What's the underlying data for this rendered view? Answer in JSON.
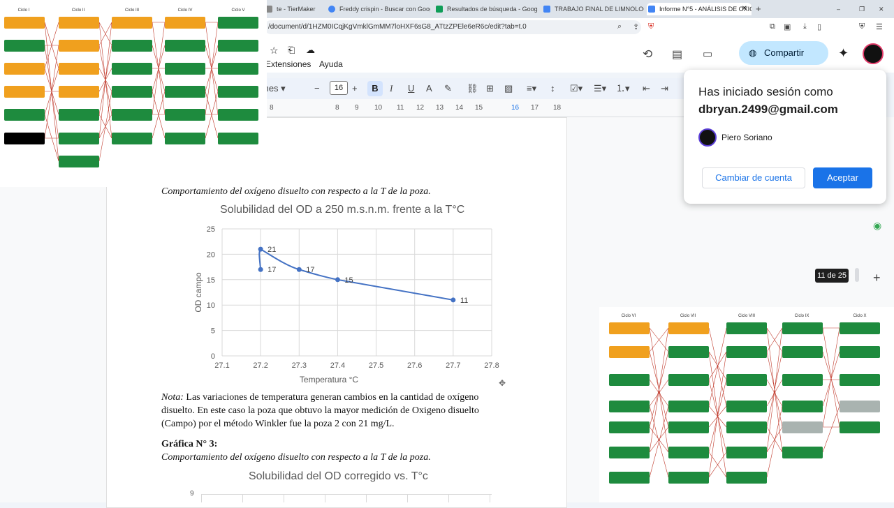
{
  "browser": {
    "tabs": [
      {
        "label": "te - TierMaker",
        "icon_color": "#888888"
      },
      {
        "label": "Freddy crispin - Buscar con Google",
        "icon_color": "#4285f4"
      },
      {
        "label": "Resultados de búsqueda - Google D",
        "icon_color": "#0f9d58"
      },
      {
        "label": "TRABAJO FINAL DE LIMNOLOGÍA M",
        "icon_color": "#4285f4"
      },
      {
        "label": "Informe N°5 - ANÁLISIS DE OXIG",
        "icon_color": "#4285f4"
      }
    ],
    "new_tab": "+",
    "window_controls": [
      "–",
      "❐",
      "✕"
    ],
    "url": "/document/d/1HZM0ICqjKgVmklGmMM7loHXF6sG8_ATtzZPEle6eR6c/edit?tab=t.0"
  },
  "docs": {
    "menu": [
      "Extensiones",
      "Ayuda"
    ],
    "share_label": "Compartir",
    "font_name": "mes",
    "font_size": "16",
    "ruler_numbers": [
      "8",
      "9",
      "10",
      "11",
      "12",
      "13",
      "14",
      "15",
      "16",
      "17",
      "18"
    ]
  },
  "document": {
    "caption1": "Comportamiento del oxígeno disuelto con respecto a la T de la poza.",
    "nota_label": "Nota:",
    "nota_text": " Las variaciones de temperatura generan cambios en la cantidad de oxígeno disuelto. En este caso la poza que obtuvo la mayor medición de Oxigeno disuelto (Campo) por el método Winkler fue la poza 2 con 21 mg/L.",
    "heading3": "Gráfica N° 3:",
    "caption2": "Comportamiento del oxígeno disuelto con respecto a la T de la poza.",
    "chart2_title": "Solubilidad del OD corregido vs. T°c",
    "chart2_ytick": "9"
  },
  "chart_data": {
    "type": "line",
    "title": "Solubilidad del OD a 250 m.s.n.m. frente a la T°C",
    "xlabel": "Temperatura °C",
    "ylabel": "OD campo",
    "xlim": [
      27.1,
      27.8
    ],
    "ylim": [
      0,
      25
    ],
    "xticks": [
      "27.1",
      "27.2",
      "27.3",
      "27.4",
      "27.5",
      "27.6",
      "27.7",
      "27.8"
    ],
    "yticks": [
      "0",
      "5",
      "10",
      "15",
      "20",
      "25"
    ],
    "grid": true,
    "series": [
      {
        "x": [
          27.2,
          27.2,
          27.3,
          27.4,
          27.7
        ],
        "y": [
          17,
          21,
          17,
          15,
          11
        ],
        "labels": [
          "17",
          "21",
          "17",
          "15",
          "11"
        ],
        "color": "#4472c4"
      }
    ]
  },
  "account_popup": {
    "line1": "Has iniciado sesión como",
    "email": "dbryan.2499@gmail.com",
    "name": "Piero Soriano",
    "switch_label": "Cambiar de cuenta",
    "accept_label": "Aceptar"
  },
  "page_indicator": "11 de 25",
  "overlay_top": {
    "cycles": [
      "Ciclo I",
      "Ciclo II",
      "Ciclo III",
      "Ciclo IV",
      "Ciclo V"
    ]
  },
  "overlay_bottom": {
    "cycles": [
      "Ciclo VI",
      "Ciclo VII",
      "Ciclo VIII",
      "Ciclo IX",
      "Ciclo X"
    ]
  }
}
